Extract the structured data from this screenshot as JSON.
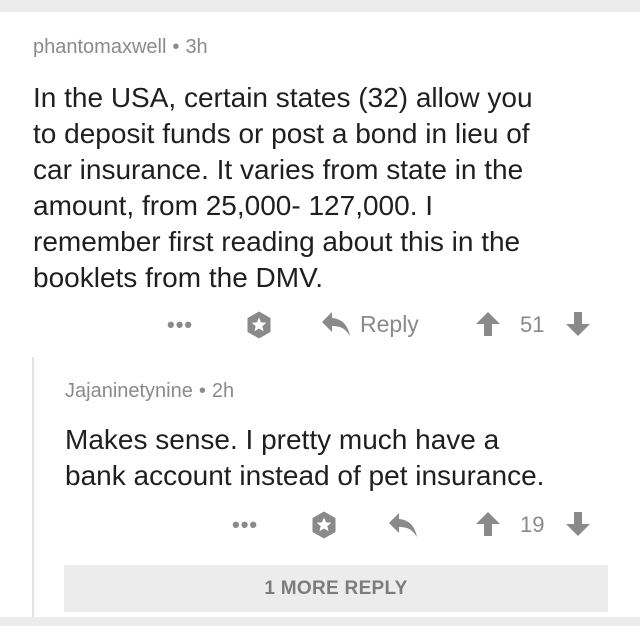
{
  "comments": [
    {
      "author": "phantomaxwell",
      "separator": "•",
      "age": "3h",
      "body_lines": [
        "In the USA, certain states (32) allow you",
        "to deposit funds or post a bond in lieu of",
        "car insurance.  It varies from state in the",
        "amount, from 25,000- 127,000.  I",
        "remember first reading about this in the",
        "booklets from the DMV."
      ],
      "more_label": "•••",
      "reply_label": "Reply",
      "score": "51"
    },
    {
      "author": "Jajaninetynine",
      "separator": "•",
      "age": "2h",
      "body_lines": [
        "Makes sense. I pretty much have a",
        "bank account instead of pet insurance."
      ],
      "more_label": "•••",
      "score": "19"
    }
  ],
  "load_more": {
    "label": "1 MORE REPLY"
  },
  "colors": {
    "text_primary": "#1f1f1f",
    "text_meta": "#8a8a8a",
    "divider": "#ececec",
    "thread_line": "#e3e3e3"
  },
  "icons": {
    "more": "more-options-icon",
    "save": "star-badge-icon",
    "reply": "reply-arrow-icon",
    "upvote": "upvote-arrow-icon",
    "downvote": "downvote-arrow-icon"
  }
}
